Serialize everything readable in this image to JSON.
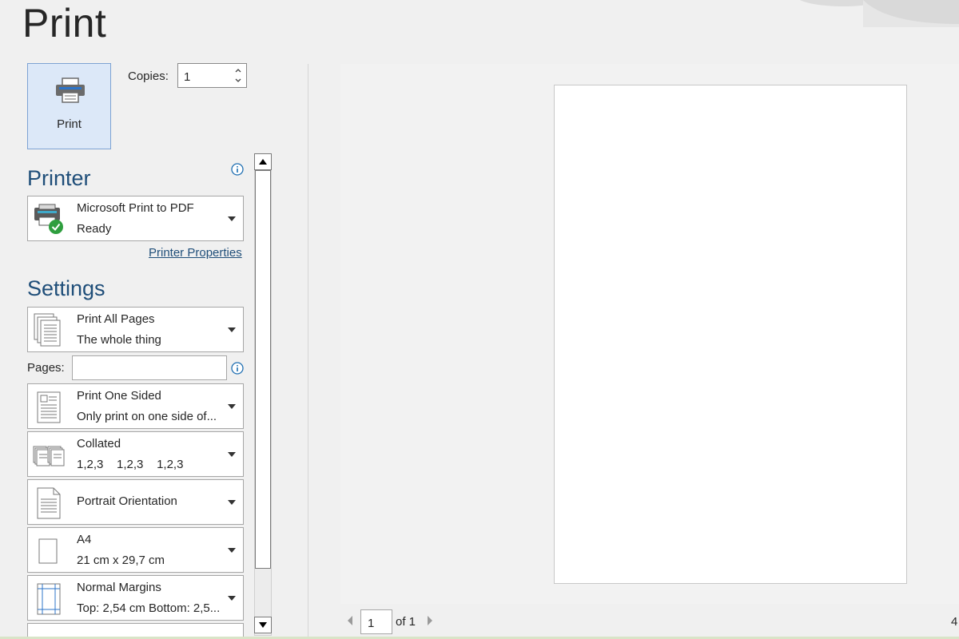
{
  "page": {
    "title": "Print"
  },
  "print_button": {
    "label": "Print"
  },
  "copies": {
    "label": "Copies:",
    "value": "1"
  },
  "printer": {
    "section_title": "Printer",
    "name": "Microsoft Print to PDF",
    "status": "Ready",
    "properties_link": "Printer Properties"
  },
  "settings": {
    "section_title": "Settings",
    "pages_range": {
      "title": "Print All Pages",
      "subtitle": "The whole thing"
    },
    "pages_label": "Pages:",
    "pages_value": "",
    "sides": {
      "title": "Print One Sided",
      "subtitle": "Only print on one side of..."
    },
    "collation": {
      "title": "Collated",
      "subtitle": "1,2,3    1,2,3    1,2,3"
    },
    "orientation": {
      "title": "Portrait Orientation"
    },
    "paper": {
      "title": "A4",
      "subtitle": "21 cm x 29,7 cm"
    },
    "margins": {
      "title": "Normal Margins",
      "subtitle": "Top: 2,54 cm Bottom: 2,5..."
    }
  },
  "preview": {
    "current_page": "1",
    "of_pages": "of 1",
    "zoom_peek": "4"
  },
  "colors": {
    "accent": "#1f4e79",
    "button_bg": "#dce8f8",
    "status_ok": "#2e9e3e"
  }
}
